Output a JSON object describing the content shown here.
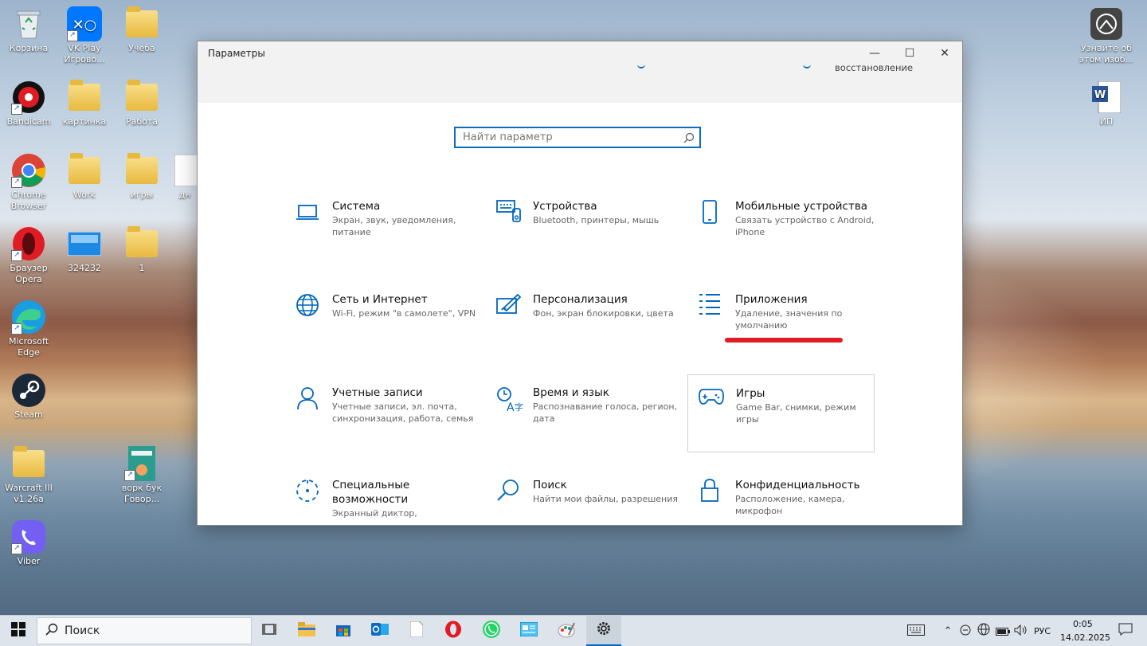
{
  "desktop": {
    "icons": [
      {
        "label": "Корзина"
      },
      {
        "label": "VK Play Игрово..."
      },
      {
        "label": "Учеба"
      },
      {
        "label": "Bandicam"
      },
      {
        "label": "картинка"
      },
      {
        "label": "Работа"
      },
      {
        "label": "Chrome Browser"
      },
      {
        "label": "Work"
      },
      {
        "label": "игры"
      },
      {
        "label": "дн"
      },
      {
        "label": "Браузер Opera"
      },
      {
        "label": "324232"
      },
      {
        "label": "1"
      },
      {
        "label": "Microsoft Edge"
      },
      {
        "label": "Steam"
      },
      {
        "label": "Warcraft III v1.26a"
      },
      {
        "label": "ворк бук Говор..."
      },
      {
        "label": "Viber"
      },
      {
        "label": "Узнайте об этом изоб..."
      },
      {
        "label": "ИП"
      }
    ]
  },
  "window": {
    "title": "Параметры",
    "minimize": "—",
    "maximize": "☐",
    "close": "✕",
    "partial_text": "восстановление"
  },
  "search": {
    "placeholder": "Найти параметр"
  },
  "tiles": [
    {
      "title": "Система",
      "desc": "Экран, звук, уведомления, питание",
      "icon": "laptop-icon"
    },
    {
      "title": "Устройства",
      "desc": "Bluetooth, принтеры, мышь",
      "icon": "keyboard-icon"
    },
    {
      "title": "Мобильные устройства",
      "desc": "Связать устройство с Android, iPhone",
      "icon": "phone-icon"
    },
    {
      "title": "Сеть и Интернет",
      "desc": "Wi-Fi, режим \"в самолете\", VPN",
      "icon": "globe-icon"
    },
    {
      "title": "Персонализация",
      "desc": "Фон, экран блокировки, цвета",
      "icon": "paint-icon"
    },
    {
      "title": "Приложения",
      "desc": "Удаление, значения по умолчанию",
      "icon": "apps-list-icon"
    },
    {
      "title": "Учетные записи",
      "desc": "Учетные записи, эл. почта, синхронизация, работа, семья",
      "icon": "person-icon"
    },
    {
      "title": "Время и язык",
      "desc": "Распознавание голоса, регион, дата",
      "icon": "time-language-icon"
    },
    {
      "title": "Игры",
      "desc": "Game Bar, снимки, режим игры",
      "icon": "gamepad-icon"
    },
    {
      "title": "Специальные возможности",
      "desc": "Экранный диктор,",
      "icon": "accessibility-icon"
    },
    {
      "title": "Поиск",
      "desc": "Найти мои файлы, разрешения",
      "icon": "search-icon"
    },
    {
      "title": "Конфиденциальность",
      "desc": "Расположение, камера, микрофон",
      "icon": "lock-icon"
    }
  ],
  "taskbar": {
    "search_label": "Поиск",
    "language": "РУС",
    "time": "0:05",
    "date": "14.02.2025"
  },
  "colors": {
    "accent": "#0067c0",
    "annotation": "#e01b24"
  }
}
